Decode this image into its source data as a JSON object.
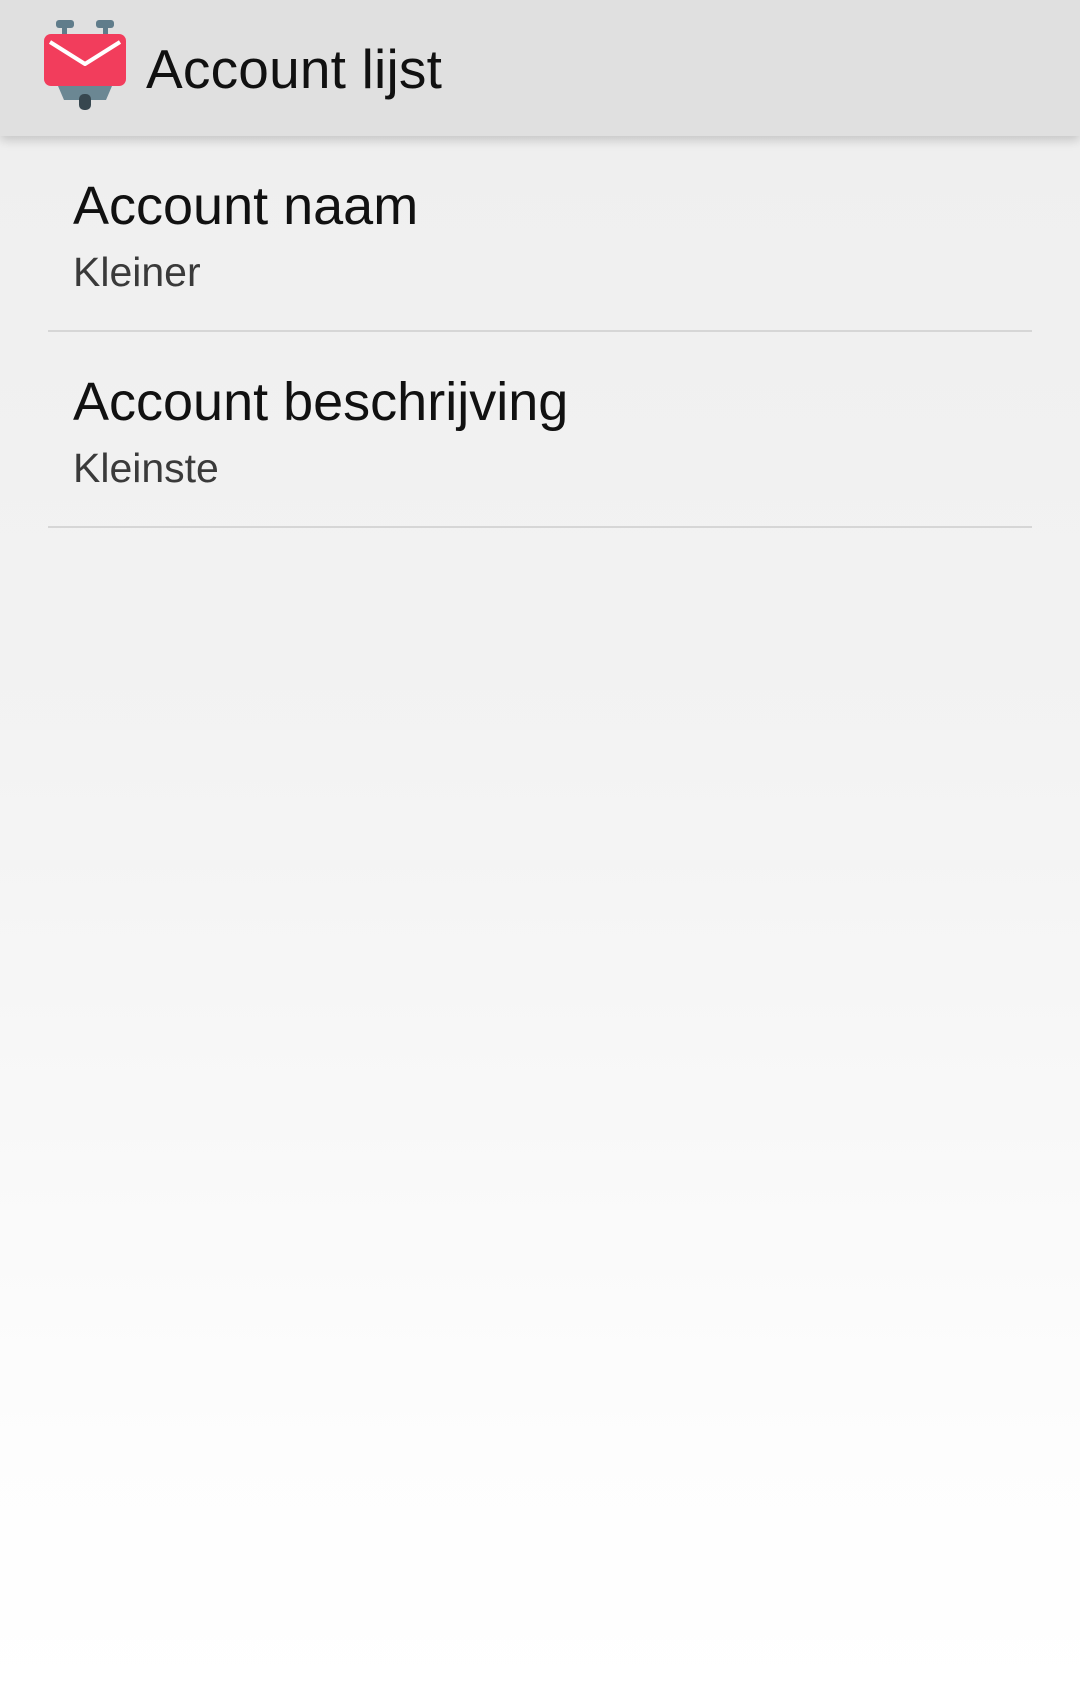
{
  "app_bar": {
    "icon": "k9-mail-icon",
    "title": "Account lijst"
  },
  "preferences": [
    {
      "title": "Account naam",
      "summary": "Kleiner"
    },
    {
      "title": "Account beschrijving",
      "summary": "Kleinste"
    }
  ],
  "colors": {
    "app_bar_bg": "#e0e0e0",
    "icon_red": "#f23d5c",
    "icon_slate": "#607d8b",
    "divider": "#d6d6d6"
  }
}
